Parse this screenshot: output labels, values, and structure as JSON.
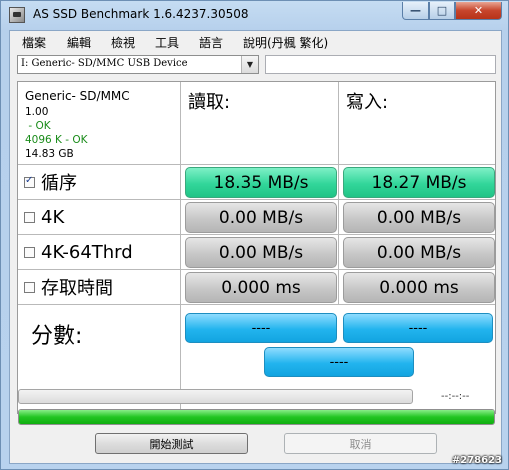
{
  "window": {
    "title": "AS SSD Benchmark 1.6.4237.30508",
    "min_label": "—",
    "max_label": "□",
    "close_label": "✕"
  },
  "menu": [
    "檔案",
    "編輯",
    "檢視",
    "工具",
    "語言",
    "說明(丹楓 繁化)"
  ],
  "device": {
    "selected": "I: Generic- SD/MMC USB Device",
    "info": {
      "name": "Generic- SD/MMC",
      "version": "1.00",
      "status1": " - OK",
      "status2": "4096 K - OK",
      "size": "14.83 GB"
    }
  },
  "columns": {
    "read": "讀取:",
    "write": "寫入:"
  },
  "rows": [
    {
      "label": "循序",
      "checked": true,
      "read": "18.35 MB/s",
      "write": "18.27 MB/s",
      "state": "done"
    },
    {
      "label": "4K",
      "checked": false,
      "read": "0.00 MB/s",
      "write": "0.00 MB/s",
      "state": "idle"
    },
    {
      "label": "4K-64Thrd",
      "checked": false,
      "read": "0.00 MB/s",
      "write": "0.00 MB/s",
      "state": "idle"
    },
    {
      "label": "存取時間",
      "checked": false,
      "read": "0.000 ms",
      "write": "0.000 ms",
      "state": "idle"
    }
  ],
  "score": {
    "label": "分數:",
    "read": "----",
    "write": "----",
    "total": "----"
  },
  "progress": {
    "time_text": "--:--:--",
    "overall_fraction": 1.0,
    "current_fraction": 0.0
  },
  "buttons": {
    "start": "開始測試",
    "cancel": "取消"
  },
  "watermark": "#278623",
  "colors": {
    "done": "#32d69a",
    "idle": "#c7c7c7",
    "score": "#22b4ee",
    "progress": "#22c522"
  }
}
